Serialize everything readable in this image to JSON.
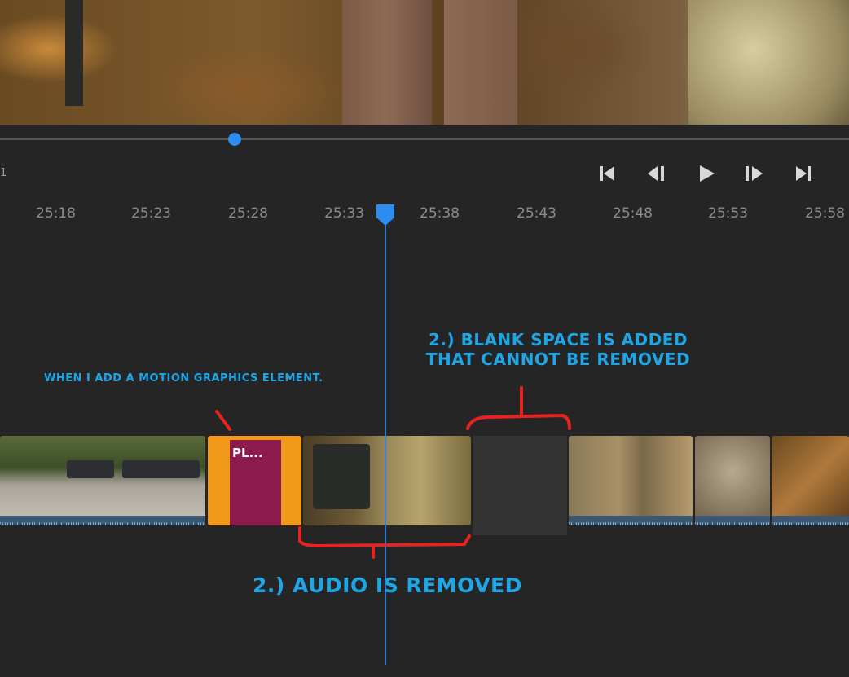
{
  "player": {
    "frame_label": "1",
    "scrub_position_fraction": 0.28,
    "controls": [
      "skip-to-start-icon",
      "step-back-icon",
      "play-icon",
      "step-forward-icon",
      "skip-to-end-icon"
    ]
  },
  "timeline": {
    "ticks": [
      "25:18",
      "25:23",
      "25:28",
      "25:33",
      "25:38",
      "25:43",
      "25:48",
      "25:53",
      "25:58"
    ],
    "playhead_color": "#2d8cf0",
    "clips": [
      {
        "name": "clip-vehicles"
      },
      {
        "name": "clip-motion-graphic",
        "label": "PL..."
      },
      {
        "name": "clip-utv-trail"
      },
      {
        "name": "clip-stone-wall"
      },
      {
        "name": "clip-blurred-leaves"
      },
      {
        "name": "clip-forest-floor"
      }
    ]
  },
  "annotations": {
    "note1": "WHEN I ADD A MOTION GRAPHICS ELEMENT.",
    "note2_line1": "2.) BLANK SPACE IS ADDED",
    "note2_line2": "THAT CANNOT BE REMOVED",
    "note3": "2.) AUDIO IS REMOVED",
    "annotation_color": "#1fa6e6",
    "marker_color": "#e8231f"
  }
}
